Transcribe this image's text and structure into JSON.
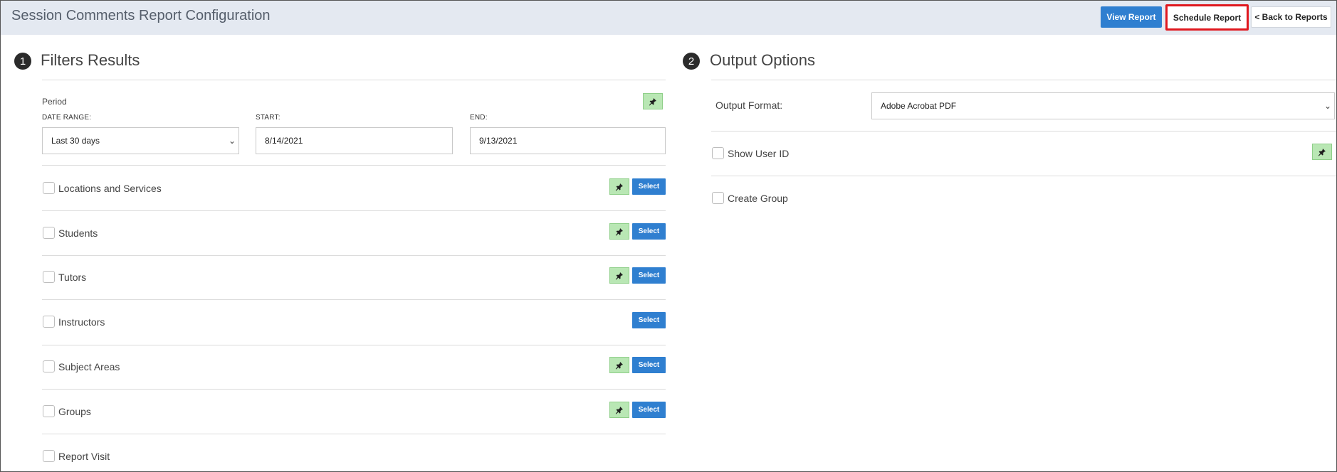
{
  "header": {
    "title": "Session Comments Report Configuration",
    "view_report": "View Report",
    "schedule_report": "Schedule Report",
    "back_to_reports": "< Back to Reports"
  },
  "filters": {
    "number": "1",
    "title": "Filters Results",
    "period_label": "Period",
    "date_range_label": "DATE RANGE:",
    "date_range_value": "Last 30 days",
    "start_label": "START:",
    "start_value": "8/14/2021",
    "end_label": "END:",
    "end_value": "9/13/2021",
    "select_label": "Select",
    "rows": [
      {
        "label": "Locations and Services"
      },
      {
        "label": "Students"
      },
      {
        "label": "Tutors"
      },
      {
        "label": "Instructors"
      },
      {
        "label": "Subject Areas"
      },
      {
        "label": "Groups"
      },
      {
        "label": "Report Visit"
      }
    ]
  },
  "output": {
    "number": "2",
    "title": "Output Options",
    "format_label": "Output Format:",
    "format_value": "Adobe Acrobat PDF",
    "show_user_id": "Show User ID",
    "create_group": "Create Group"
  },
  "icons": {
    "pin": "pin-icon",
    "chevron": "chevron-down-icon"
  },
  "colors": {
    "primary_button": "#2f7fd0",
    "pin_button": "#b9e7b4",
    "highlight_border": "#e0171e",
    "header_bg": "#e4e9f1"
  }
}
